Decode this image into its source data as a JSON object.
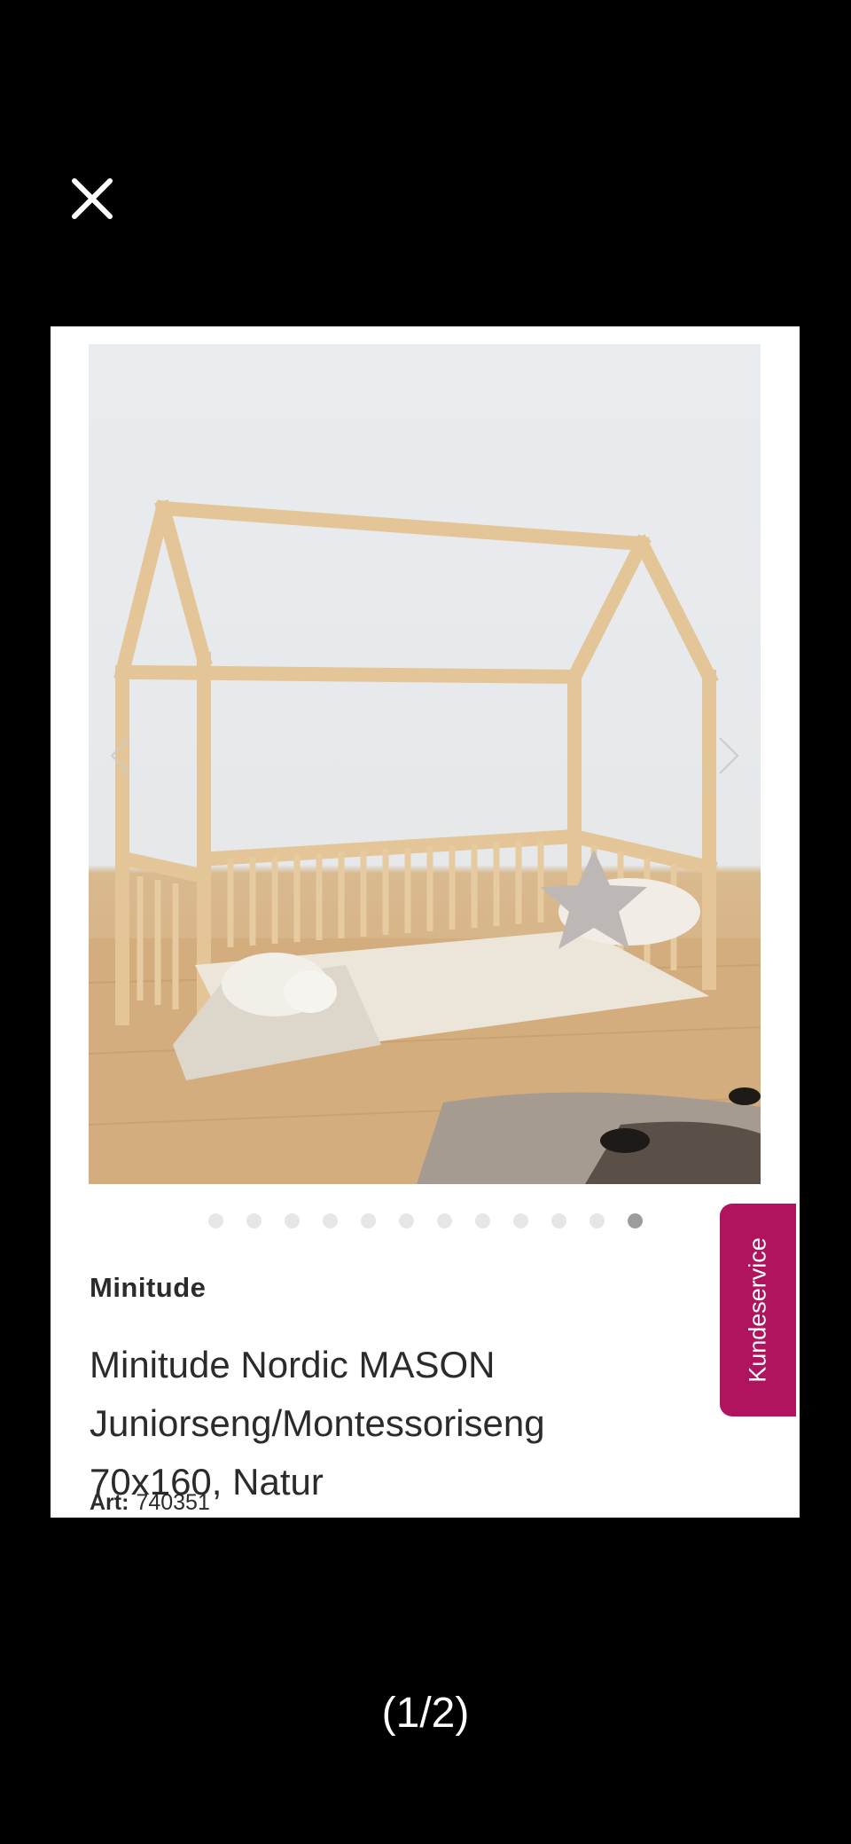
{
  "viewer": {
    "close_icon": "close-icon",
    "pager": "(1/2)"
  },
  "product": {
    "brand": "Minitude",
    "title_lines": [
      "Minitude Nordic MASON",
      "Juniorseng/Montessoriseng",
      "70x160, Natur"
    ],
    "art_label": "Art:",
    "art_number": "740351"
  },
  "gallery": {
    "image_count": 12,
    "active_index": 11,
    "prev_icon": "chevron-left-icon",
    "next_icon": "chevron-right-icon"
  },
  "service_tab": {
    "label": "Kundeservice",
    "color": "#b0145e"
  }
}
